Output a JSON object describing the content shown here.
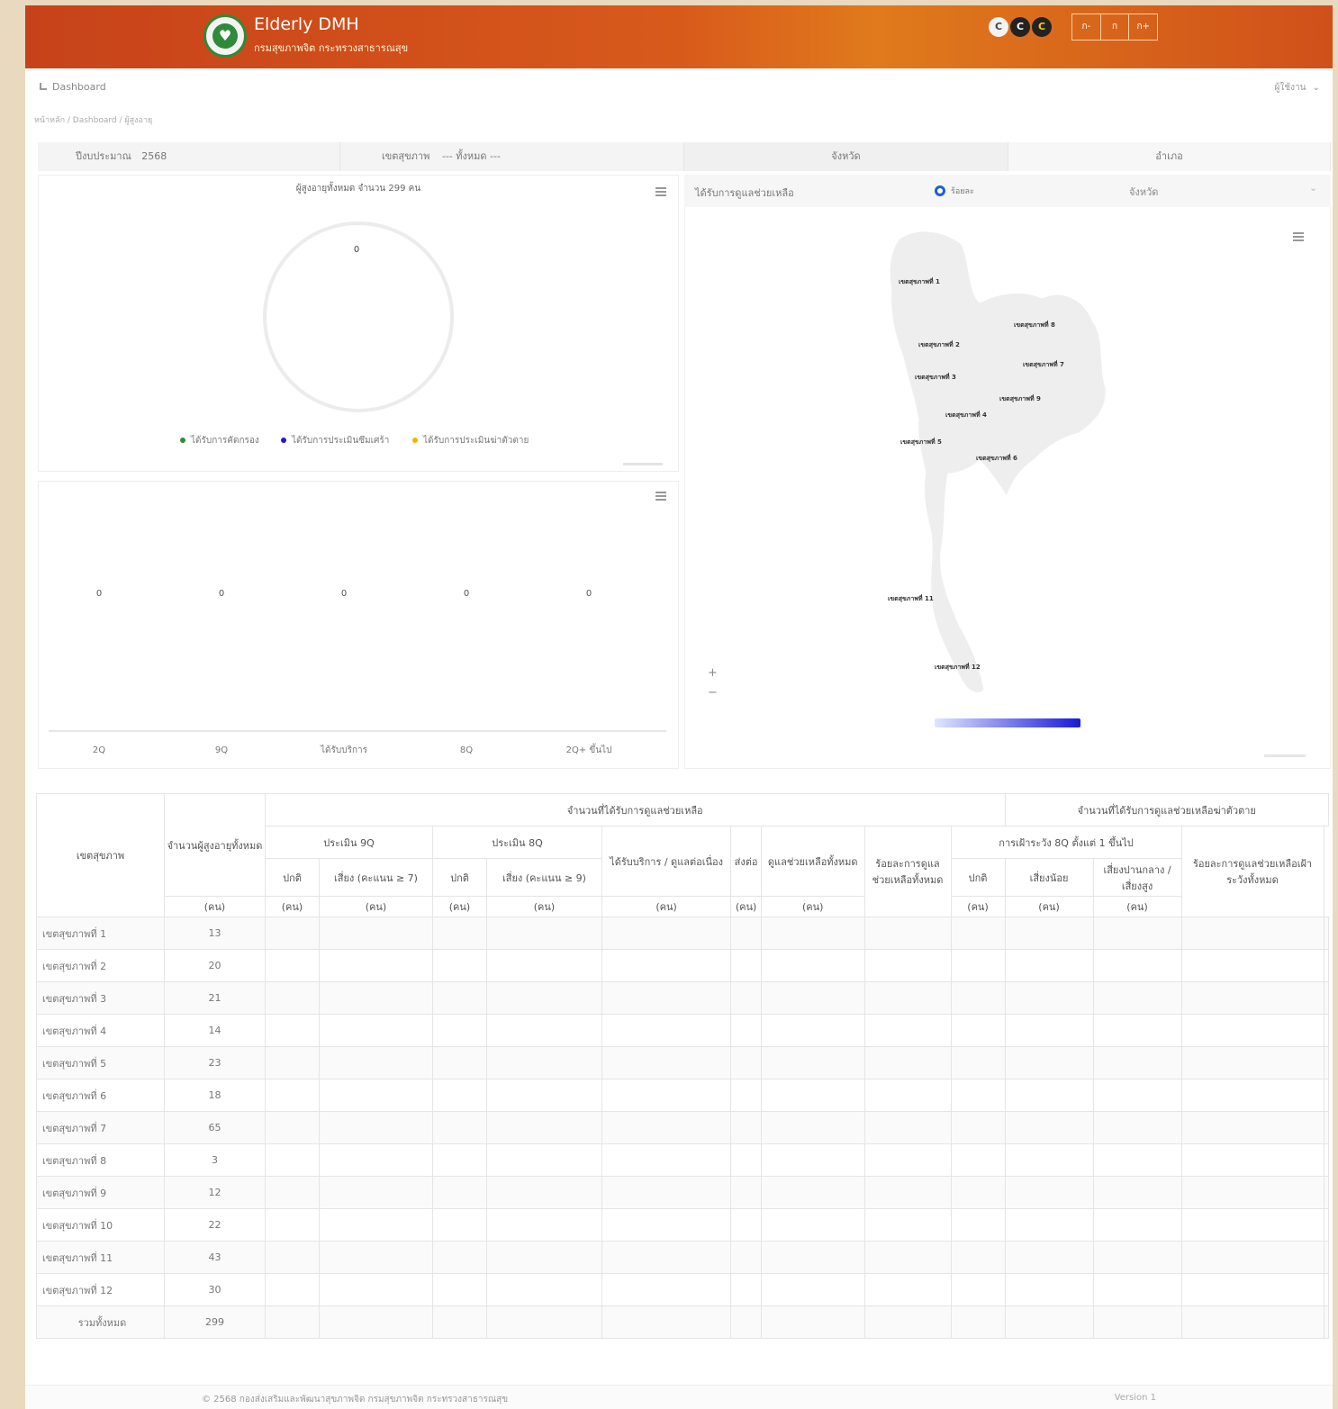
{
  "header": {
    "brand_title": "Elderly DMH",
    "brand_subtitle": "กรมสุขภาพจิต กระทรวงสาธารณสุข",
    "logo_glyph": "♥",
    "contrast_buttons": [
      "C",
      "C",
      "C"
    ],
    "font_size_buttons": [
      "ก-",
      "ก",
      "ก+"
    ]
  },
  "nav": {
    "dashboard_label": "Dashboard",
    "user_menu": "ผู้ใช้งาน",
    "breadcrumb": "หน้าหลัก / Dashboard / ผู้สูงอายุ"
  },
  "filters": {
    "year_label": "ปีงบประมาณ",
    "year_value": "2568",
    "health_area_label": "เขตสุขภาพ",
    "health_area_value": "--- ทั้งหมด ---",
    "tab_province": "จังหวัด",
    "tab_district": "อำเภอ"
  },
  "donut_chart": {
    "title": "ผู้สูงอายุทั้งหมด จำนวน 299 คน",
    "center_value": "0",
    "legend": [
      {
        "label": "ได้รับการคัดกรอง",
        "color": "#2e8b3a"
      },
      {
        "label": "ได้รับการประเมินซึมเศร้า",
        "color": "#1b1bd6"
      },
      {
        "label": "ได้รับการประเมินฆ่าตัวตาย",
        "color": "#f0b400"
      }
    ]
  },
  "chart_data": {
    "type": "bar",
    "categories": [
      "2Q",
      "9Q",
      "ได้รับบริการ",
      "8Q",
      "2Q+ ขึ้นไป"
    ],
    "values": [
      0,
      0,
      0,
      0,
      0
    ],
    "value_labels": [
      "0",
      "0",
      "0",
      "0",
      "0"
    ]
  },
  "map": {
    "indicator_label": "ได้รับการดูแลช่วยเหลือ",
    "radio_label": "ร้อยละ",
    "select_label": "จังหวัด",
    "zoom_in": "+",
    "zoom_out": "−",
    "regions": [
      "เขตสุขภาพที่ 1",
      "เขตสุขภาพที่ 8",
      "เขตสุขภาพที่ 2",
      "เขตสุขภาพที่ 7",
      "เขตสุขภาพที่ 3",
      "เขตสุขภาพที่ 9",
      "เขตสุขภาพที่ 4",
      "เขตสุขภาพที่ 5",
      "เขตสุขภาพที่ 6",
      "เขตสุขภาพที่ 11",
      "เขตสุขภาพที่ 12"
    ],
    "gradient_start": "#dfe6ff",
    "gradient_end": "#1a1ad8"
  },
  "table": {
    "col_region": "เขตสุขภาพ",
    "col_total": "จำนวนผู้สูงอายุทั้งหมด",
    "col_unit_person": "(คน)",
    "group_screened": "จำนวนที่ได้รับการดูแลช่วยเหลือ",
    "group_suicide": "จำนวนที่ได้รับการดูแลช่วยเหลือฆ่าตัวตาย",
    "sub_2q": "ประเมิน 9Q",
    "sub_8q": "ประเมิน 8Q",
    "sub_service": "ได้รับบริการ / ดูแลต่อเนื่อง",
    "sub_refer": "ส่งต่อ",
    "sub_total_help": "ดูแลช่วยเหลือทั้งหมด",
    "sub_percent_help": "ร้อยละการดูแลช่วยเหลือทั้งหมด",
    "sub_suicide_eval": "การเฝ้าระวัง 8Q ตั้งแต่ 1 ขึ้นไป",
    "sub_percent_suicide": "ร้อยละการดูแลช่วยเหลือเฝ้าระวังทั้งหมด",
    "leaf_normal": "ปกติ",
    "leaf_risk": "เสี่ยง (คะแนน ≥ 7)",
    "leaf_risk8": "เสี่ยง (คะแนน ≥ 9)",
    "leaf_mild": "เสี่ยงน้อย",
    "leaf_moderate": "เสี่ยงปานกลาง / เสี่ยงสูง",
    "rows": [
      {
        "region": "เขตสุขภาพที่ 1",
        "total": "13"
      },
      {
        "region": "เขตสุขภาพที่ 2",
        "total": "20"
      },
      {
        "region": "เขตสุขภาพที่ 3",
        "total": "21"
      },
      {
        "region": "เขตสุขภาพที่ 4",
        "total": "14"
      },
      {
        "region": "เขตสุขภาพที่ 5",
        "total": "23"
      },
      {
        "region": "เขตสุขภาพที่ 6",
        "total": "18"
      },
      {
        "region": "เขตสุขภาพที่ 7",
        "total": "65"
      },
      {
        "region": "เขตสุขภาพที่ 8",
        "total": "3"
      },
      {
        "region": "เขตสุขภาพที่ 9",
        "total": "12"
      },
      {
        "region": "เขตสุขภาพที่ 10",
        "total": "22"
      },
      {
        "region": "เขตสุขภาพที่ 11",
        "total": "43"
      },
      {
        "region": "เขตสุขภาพที่ 12",
        "total": "30"
      }
    ],
    "total_label": "รวมทั้งหมด",
    "total_value": "299"
  },
  "footer": {
    "copyright": "© 2568 กองส่งเสริมและพัฒนาสุขภาพจิต กรมสุขภาพจิต กระทรวงสาธารณสุข",
    "version": "Version 1"
  }
}
